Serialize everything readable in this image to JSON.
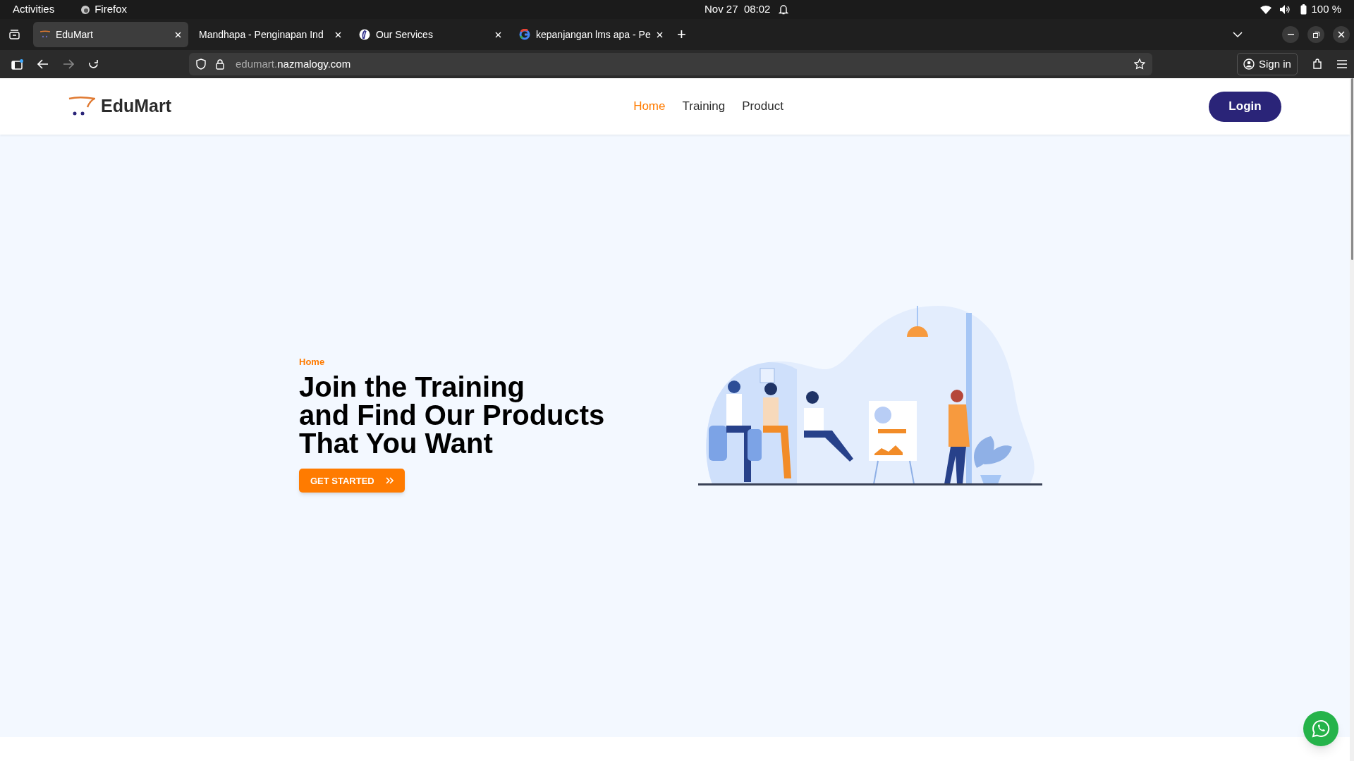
{
  "system_bar": {
    "activities": "Activities",
    "app": "Firefox",
    "clock": "Nov 27  08:02",
    "battery": "100 %"
  },
  "tabs": [
    {
      "title": "EduMart",
      "selected": true
    },
    {
      "title": "Mandhapa - Penginapan Ind",
      "selected": false
    },
    {
      "title": "Our Services",
      "selected": false
    },
    {
      "title": "kepanjangan lms apa - Pe",
      "selected": false
    }
  ],
  "new_tab": "+",
  "address_bar": {
    "subdomain": "edumart.",
    "domain": "nazmalogy.com"
  },
  "toolbar": {
    "sign_in": "Sign in"
  },
  "site": {
    "logo": "EduMart",
    "nav": [
      {
        "label": "Home",
        "selected": true
      },
      {
        "label": "Training",
        "selected": false
      },
      {
        "label": "Product",
        "selected": false
      }
    ],
    "login": "Login",
    "hero": {
      "breadcrumb": "Home",
      "heading": "Join the Training\nand Find Our Products\nThat You Want",
      "button": "GET STARTED"
    }
  }
}
